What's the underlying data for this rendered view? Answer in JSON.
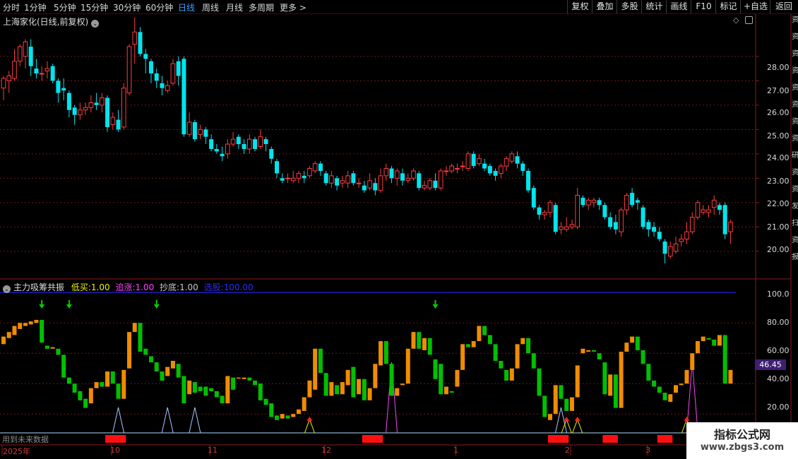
{
  "toolbar": {
    "periods": [
      "分时",
      "1分钟",
      "5分钟",
      "15分钟",
      "30分钟",
      "60分钟",
      "日线",
      "周线",
      "月线",
      "多周期",
      "更多 >"
    ],
    "active_period": "日线",
    "right_buttons": [
      "复权",
      "叠加",
      "多股",
      "统计",
      "画线",
      "F10",
      "标记",
      "+自选",
      "返回"
    ]
  },
  "chart_title": "上海家化(日线,前复权)",
  "main_y_labels": [
    "28.00",
    "27.00",
    "26.00",
    "25.00",
    "24.00",
    "23.00",
    "22.00",
    "21.00",
    "20.00"
  ],
  "indicator": {
    "name": "主力吸筹共振",
    "items": [
      {
        "label": "低买:",
        "value": "1.00",
        "color": "#f0f000"
      },
      {
        "label": "追涨:",
        "value": "1.00",
        "color": "#ff40ff"
      },
      {
        "label": "抄底:",
        "value": "1.00",
        "color": "#c8c8c8"
      },
      {
        "label": "选股:",
        "value": "100.00",
        "color": "#2020ff"
      }
    ],
    "y_labels": [
      "100.0",
      "80.00",
      "60.00",
      "40.00",
      "20.00"
    ],
    "current_value": "46.45",
    "future_label": "用到未来数据"
  },
  "x_labels": [
    "2025年",
    "10",
    "11",
    "12",
    "1",
    "2",
    "3"
  ],
  "side_text": [
    "资",
    "资",
    "资",
    "资",
    "资",
    "资",
    "资",
    "资",
    "研",
    "资",
    "资",
    "发",
    "扫",
    "资",
    "报"
  ],
  "watermark": {
    "title": "指标公式网",
    "url": "www.zbgs3.com"
  },
  "colors": {
    "up": "#ff3d3d",
    "down": "#00e5ee",
    "bar_up": "#f08c00",
    "bar_down": "#00c000",
    "grid": "#6b1818"
  },
  "chart_data": {
    "type": "candlestick",
    "y_range": [
      19.3,
      29.3
    ],
    "candles": [
      [
        26.7,
        27.1,
        26.2,
        27.2
      ],
      [
        27.0,
        27.2,
        26.5,
        27.4
      ],
      [
        27.1,
        27.8,
        27.0,
        28.3
      ],
      [
        27.8,
        28.4,
        27.6,
        28.5
      ],
      [
        28.0,
        28.6,
        27.5,
        28.7
      ],
      [
        28.4,
        27.6,
        27.2,
        28.7
      ],
      [
        27.5,
        27.3,
        27.1,
        27.9
      ],
      [
        27.3,
        27.3,
        27.0,
        27.6
      ],
      [
        27.4,
        27.5,
        27.1,
        27.8
      ],
      [
        27.6,
        27.0,
        26.9,
        27.7
      ],
      [
        27.0,
        26.5,
        26.1,
        27.1
      ],
      [
        26.7,
        26.6,
        26.2,
        27.1
      ],
      [
        26.5,
        25.8,
        25.5,
        26.6
      ],
      [
        25.9,
        25.6,
        25.2,
        26.0
      ],
      [
        25.6,
        25.8,
        25.4,
        26.1
      ],
      [
        25.8,
        25.9,
        25.6,
        26.1
      ],
      [
        25.9,
        26.1,
        25.7,
        26.4
      ],
      [
        26.1,
        26.0,
        25.8,
        26.5
      ],
      [
        26.0,
        26.3,
        25.7,
        26.5
      ],
      [
        26.3,
        25.1,
        24.9,
        26.4
      ],
      [
        25.2,
        25.5,
        25.0,
        25.7
      ],
      [
        25.4,
        25.0,
        24.9,
        25.8
      ],
      [
        25.1,
        26.7,
        25.0,
        26.9
      ],
      [
        26.5,
        28.4,
        26.4,
        28.5
      ],
      [
        28.5,
        29.0,
        27.7,
        29.6
      ],
      [
        29.0,
        28.1,
        28.0,
        29.2
      ],
      [
        28.1,
        27.9,
        27.3,
        28.3
      ],
      [
        27.8,
        27.3,
        26.9,
        27.9
      ],
      [
        27.3,
        27.0,
        26.7,
        27.5
      ],
      [
        26.9,
        26.7,
        26.4,
        27.2
      ],
      [
        26.6,
        26.8,
        26.5,
        27.0
      ],
      [
        26.9,
        27.7,
        26.8,
        27.9
      ],
      [
        27.8,
        27.2,
        26.8,
        28.0
      ],
      [
        27.9,
        24.8,
        24.7,
        28.0
      ],
      [
        24.8,
        25.3,
        24.7,
        25.7
      ],
      [
        25.3,
        24.6,
        24.5,
        25.4
      ],
      [
        24.8,
        25.0,
        24.6,
        25.2
      ],
      [
        25.0,
        24.7,
        24.4,
        25.1
      ],
      [
        24.6,
        24.2,
        24.1,
        24.8
      ],
      [
        24.2,
        24.1,
        24.0,
        24.4
      ],
      [
        24.0,
        23.9,
        23.7,
        24.3
      ],
      [
        24.0,
        24.4,
        23.8,
        24.6
      ],
      [
        24.4,
        24.6,
        24.3,
        24.9
      ],
      [
        24.7,
        24.4,
        24.2,
        24.8
      ],
      [
        24.4,
        24.2,
        24.0,
        24.6
      ],
      [
        24.2,
        24.6,
        24.0,
        24.8
      ],
      [
        24.6,
        24.2,
        24.1,
        24.7
      ],
      [
        24.3,
        24.7,
        24.2,
        25.0
      ],
      [
        24.6,
        24.4,
        24.1,
        24.7
      ],
      [
        24.2,
        23.8,
        23.6,
        24.3
      ],
      [
        23.7,
        23.2,
        23.0,
        23.8
      ],
      [
        23.0,
        22.9,
        22.8,
        23.2
      ],
      [
        23.0,
        23.0,
        22.8,
        23.2
      ],
      [
        22.9,
        23.0,
        22.8,
        23.3
      ],
      [
        23.0,
        23.2,
        22.8,
        23.3
      ],
      [
        23.1,
        23.0,
        22.8,
        23.3
      ],
      [
        23.1,
        23.4,
        23.0,
        23.5
      ],
      [
        23.3,
        23.6,
        23.2,
        23.7
      ],
      [
        23.6,
        23.3,
        23.1,
        23.7
      ],
      [
        23.2,
        22.8,
        22.7,
        23.3
      ],
      [
        22.8,
        23.1,
        22.6,
        23.3
      ],
      [
        23.0,
        22.7,
        22.5,
        23.1
      ],
      [
        22.8,
        22.9,
        22.6,
        23.1
      ],
      [
        22.8,
        23.1,
        22.6,
        23.3
      ],
      [
        23.2,
        22.8,
        22.7,
        23.3
      ],
      [
        22.8,
        22.8,
        22.6,
        23.0
      ],
      [
        22.7,
        22.5,
        22.4,
        22.9
      ],
      [
        22.6,
        22.9,
        22.5,
        23.2
      ],
      [
        22.8,
        22.5,
        22.3,
        23.0
      ],
      [
        22.5,
        23.1,
        22.4,
        23.4
      ],
      [
        23.1,
        23.4,
        22.9,
        23.6
      ],
      [
        23.4,
        23.0,
        22.8,
        23.5
      ],
      [
        23.0,
        23.3,
        22.7,
        23.4
      ],
      [
        23.2,
        22.9,
        22.7,
        23.4
      ],
      [
        22.9,
        23.0,
        22.8,
        23.2
      ],
      [
        23.0,
        23.3,
        22.9,
        23.4
      ],
      [
        23.2,
        22.6,
        22.5,
        23.3
      ],
      [
        22.6,
        22.7,
        22.5,
        22.9
      ],
      [
        22.6,
        22.9,
        22.5,
        23.0
      ],
      [
        22.9,
        22.6,
        22.5,
        23.2
      ],
      [
        22.6,
        23.3,
        22.5,
        23.4
      ],
      [
        23.3,
        23.3,
        23.1,
        23.5
      ],
      [
        23.3,
        23.5,
        23.2,
        23.6
      ],
      [
        23.4,
        23.4,
        23.2,
        23.6
      ],
      [
        23.5,
        23.5,
        23.3,
        23.7
      ],
      [
        23.4,
        24.0,
        23.3,
        24.1
      ],
      [
        24.0,
        23.5,
        23.4,
        24.1
      ],
      [
        23.6,
        23.8,
        23.5,
        24.0
      ],
      [
        23.6,
        23.4,
        23.3,
        23.8
      ],
      [
        23.5,
        23.2,
        23.1,
        23.6
      ],
      [
        23.3,
        23.1,
        22.9,
        23.4
      ],
      [
        23.2,
        23.5,
        23.0,
        23.6
      ],
      [
        23.5,
        23.8,
        23.3,
        23.9
      ],
      [
        23.7,
        24.0,
        23.6,
        24.1
      ],
      [
        23.9,
        23.6,
        23.4,
        24.1
      ],
      [
        23.6,
        23.3,
        23.1,
        23.7
      ],
      [
        23.3,
        22.5,
        22.4,
        23.4
      ],
      [
        22.6,
        21.8,
        21.7,
        22.7
      ],
      [
        21.8,
        21.5,
        21.3,
        21.9
      ],
      [
        21.5,
        21.6,
        21.3,
        21.7
      ],
      [
        21.6,
        22.0,
        21.4,
        22.1
      ],
      [
        21.9,
        20.8,
        20.7,
        22.0
      ],
      [
        20.9,
        21.0,
        20.7,
        21.2
      ],
      [
        20.9,
        21.0,
        20.8,
        21.4
      ],
      [
        21.0,
        21.1,
        20.9,
        21.3
      ],
      [
        21.0,
        22.3,
        20.9,
        22.6
      ],
      [
        22.2,
        21.9,
        21.8,
        22.3
      ],
      [
        21.9,
        22.1,
        21.7,
        22.2
      ],
      [
        22.0,
        22.1,
        21.8,
        22.2
      ],
      [
        22.1,
        21.9,
        21.7,
        22.2
      ],
      [
        21.9,
        21.4,
        21.3,
        22.0
      ],
      [
        21.4,
        21.0,
        20.9,
        21.6
      ],
      [
        21.2,
        20.9,
        20.7,
        21.5
      ],
      [
        20.8,
        21.7,
        20.6,
        21.8
      ],
      [
        21.7,
        22.3,
        21.5,
        22.4
      ],
      [
        22.4,
        21.9,
        21.8,
        22.6
      ],
      [
        22.1,
        22.0,
        21.7,
        22.2
      ],
      [
        21.8,
        21.0,
        20.9,
        21.9
      ],
      [
        21.2,
        20.9,
        20.6,
        21.3
      ],
      [
        21.0,
        20.8,
        20.6,
        21.2
      ],
      [
        20.8,
        20.5,
        20.4,
        21.0
      ],
      [
        20.4,
        19.9,
        19.5,
        20.5
      ],
      [
        19.8,
        20.2,
        19.7,
        20.4
      ],
      [
        20.0,
        20.3,
        19.9,
        20.6
      ],
      [
        20.4,
        20.5,
        20.2,
        20.7
      ],
      [
        20.5,
        20.8,
        20.3,
        21.2
      ],
      [
        20.8,
        21.4,
        20.7,
        21.6
      ],
      [
        21.4,
        22.0,
        21.3,
        22.1
      ],
      [
        21.6,
        21.7,
        21.5,
        21.9
      ],
      [
        21.6,
        21.7,
        21.4,
        21.9
      ],
      [
        21.8,
        22.1,
        21.5,
        22.3
      ],
      [
        21.9,
        21.7,
        21.5,
        22.0
      ],
      [
        21.9,
        20.7,
        20.5,
        22.0
      ],
      [
        20.8,
        21.2,
        20.3,
        21.3
      ]
    ],
    "indicator_y_range": [
      8,
      102
    ],
    "indicator_bars": [
      [
        66,
        71
      ],
      [
        70,
        74
      ],
      [
        72,
        78
      ],
      [
        76,
        80
      ],
      [
        78,
        80
      ],
      [
        79,
        81
      ],
      [
        80,
        82
      ],
      [
        82,
        67
      ],
      [
        65,
        63
      ],
      [
        63,
        64
      ],
      [
        63,
        59
      ],
      [
        59,
        44
      ],
      [
        44,
        40
      ],
      [
        40,
        34
      ],
      [
        35,
        29
      ],
      [
        30,
        24
      ],
      [
        27,
        37
      ],
      [
        37,
        41
      ],
      [
        41,
        38
      ],
      [
        38,
        48
      ],
      [
        48,
        40
      ],
      [
        40,
        30
      ],
      [
        30,
        49
      ],
      [
        50,
        74
      ],
      [
        74,
        80
      ],
      [
        80,
        61
      ],
      [
        63,
        59
      ],
      [
        58,
        54
      ],
      [
        54,
        48
      ],
      [
        48,
        42
      ],
      [
        45,
        51
      ],
      [
        50,
        55
      ],
      [
        53,
        44
      ],
      [
        45,
        27
      ],
      [
        33,
        42
      ],
      [
        41,
        34
      ],
      [
        38,
        35
      ],
      [
        38,
        32
      ],
      [
        37,
        35
      ],
      [
        35,
        31
      ],
      [
        32,
        27
      ],
      [
        27,
        45
      ],
      [
        44,
        36
      ],
      [
        44,
        44
      ],
      [
        43,
        44
      ],
      [
        44,
        42
      ],
      [
        42,
        39
      ],
      [
        40,
        29
      ],
      [
        30,
        26
      ],
      [
        27,
        18
      ],
      [
        19,
        16
      ],
      [
        17,
        20
      ],
      [
        19,
        17
      ],
      [
        18,
        20
      ],
      [
        20,
        23
      ],
      [
        22,
        31
      ],
      [
        31,
        42
      ],
      [
        36,
        63
      ],
      [
        63,
        47
      ],
      [
        47,
        32
      ],
      [
        32,
        41
      ],
      [
        39,
        33
      ],
      [
        33,
        41
      ],
      [
        39,
        49
      ],
      [
        51,
        31
      ],
      [
        33,
        43
      ],
      [
        43,
        29
      ],
      [
        29,
        37
      ],
      [
        37,
        53
      ],
      [
        52,
        68
      ],
      [
        68,
        53
      ],
      [
        53,
        32
      ],
      [
        32,
        37
      ],
      [
        39,
        40
      ],
      [
        40,
        63
      ],
      [
        63,
        74
      ],
      [
        74,
        63
      ],
      [
        62,
        70
      ],
      [
        70,
        59
      ],
      [
        56,
        43
      ],
      [
        53,
        33
      ],
      [
        33,
        38
      ],
      [
        35,
        34
      ],
      [
        38,
        49
      ],
      [
        49,
        66
      ],
      [
        66,
        64
      ],
      [
        64,
        68
      ],
      [
        68,
        78
      ],
      [
        78,
        72
      ],
      [
        72,
        66
      ],
      [
        66,
        55
      ],
      [
        55,
        50
      ],
      [
        49,
        42
      ],
      [
        42,
        50
      ],
      [
        50,
        66
      ],
      [
        66,
        70
      ],
      [
        70,
        60
      ],
      [
        60,
        50
      ],
      [
        50,
        32
      ],
      [
        32,
        18
      ],
      [
        16,
        20
      ],
      [
        20,
        39
      ],
      [
        39,
        30
      ],
      [
        30,
        22
      ],
      [
        22,
        31
      ],
      [
        31,
        52
      ],
      [
        60,
        63
      ],
      [
        61,
        62
      ],
      [
        62,
        61
      ],
      [
        60,
        56
      ],
      [
        54,
        33
      ],
      [
        32,
        46
      ],
      [
        46,
        24
      ],
      [
        24,
        61
      ],
      [
        61,
        67
      ],
      [
        67,
        71
      ],
      [
        71,
        62
      ],
      [
        62,
        53
      ],
      [
        53,
        42
      ],
      [
        42,
        38
      ],
      [
        38,
        34
      ],
      [
        34,
        29
      ],
      [
        28,
        33
      ],
      [
        34,
        39
      ],
      [
        39,
        40
      ],
      [
        40,
        49
      ],
      [
        49,
        60
      ],
      [
        60,
        68
      ],
      [
        68,
        71
      ],
      [
        70,
        69
      ],
      [
        69,
        65
      ],
      [
        65,
        72
      ],
      [
        72,
        40
      ],
      [
        40,
        49
      ]
    ],
    "green_arrows": [
      7,
      12,
      28,
      79
    ],
    "red_signals": [
      56,
      103,
      105,
      125
    ],
    "purple_peaks": [
      71,
      126
    ],
    "gray_peaks": [
      21,
      30,
      35,
      102
    ],
    "red_blocks": [
      [
        19,
        22
      ],
      [
        66,
        69
      ],
      [
        100,
        103
      ],
      [
        110,
        112
      ],
      [
        120,
        122
      ]
    ]
  }
}
